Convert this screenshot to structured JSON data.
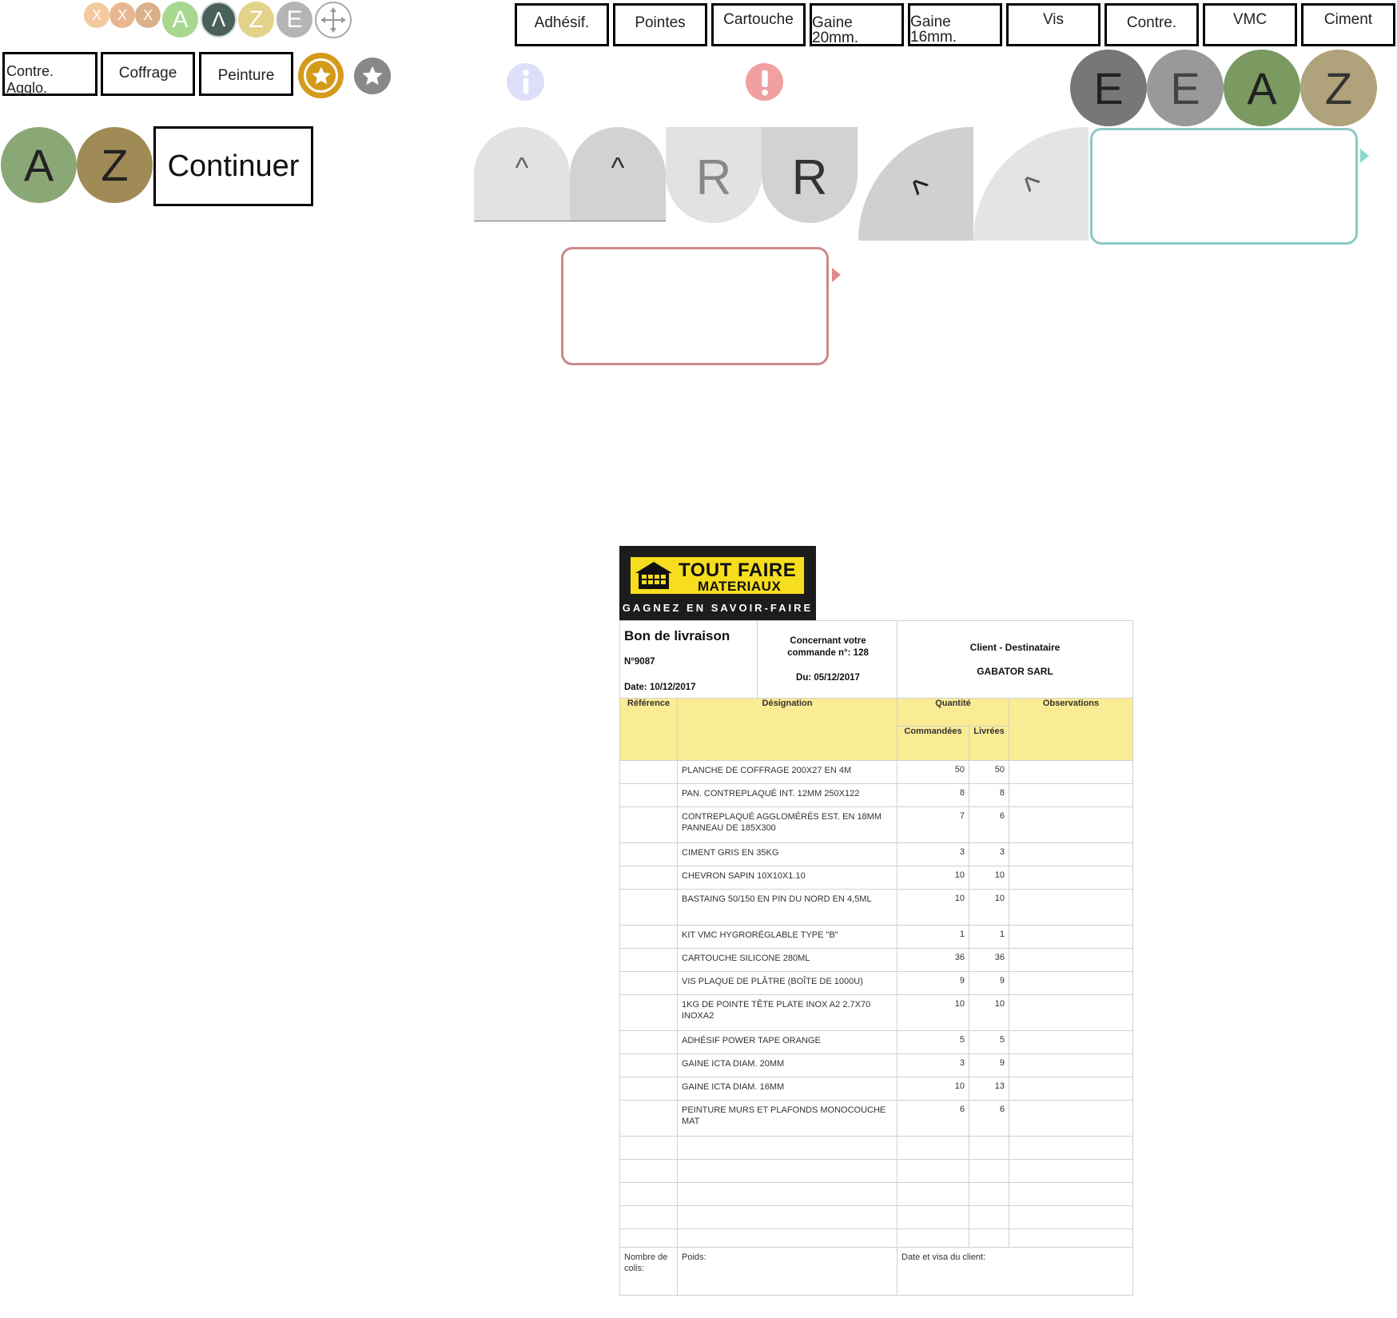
{
  "top_icons": {
    "x1": "X",
    "x2": "X",
    "x3": "X",
    "a": "A",
    "caret": "Λ",
    "z": "Z",
    "e": "E"
  },
  "top_buttons": [
    "Adhésif.",
    "Pointes",
    "Cartouche",
    "Gaine 20mm.",
    "Gaine 16mm.",
    "Vis",
    "Contre.",
    "VMC",
    "Ciment"
  ],
  "left_buttons": [
    "Contre. Agglo.",
    "Coffrage",
    "Peinture"
  ],
  "big_circles": {
    "a": "A",
    "z": "Z"
  },
  "continue_label": "Continuer",
  "right_circles": {
    "e1": "E",
    "e2": "E",
    "a": "A",
    "z": "Z"
  },
  "tabs": {
    "caret1": "^",
    "caret2": "^",
    "r1": "R",
    "r2": "R",
    "caret3": "^",
    "caret4": "^"
  },
  "colors": {
    "green": "#8aa876",
    "brown": "#a08a55",
    "gold": "#d49a1a",
    "teal": "#8cc8c4",
    "rose": "#c98a8a"
  },
  "icons": {
    "move": "move-arrows-icon",
    "star_gold": "star-icon",
    "star_gray": "star-icon",
    "info": "info-icon",
    "alert": "exclamation-icon"
  },
  "logo": {
    "line1": "TOUT FAIRE",
    "line2": "MATERIAUX",
    "tagline": "GAGNEZ EN SAVOIR-FAIRE"
  },
  "delivery_note": {
    "title": "Bon de livraison",
    "number": "N°9087",
    "date": "Date: 10/12/2017",
    "order_label": "Concernant votre commande n°: 128",
    "order_date": "Du: 05/12/2017",
    "client_label": "Client - Destinataire",
    "client_name": "GABATOR SARL",
    "headers": {
      "reference": "Référence",
      "designation": "Désignation",
      "quantity": "Quantité",
      "ordered": "Commandées",
      "delivered": "Livrées",
      "observations": "Observations"
    },
    "rows": [
      {
        "designation": "PLANCHE DE COFFRAGE 200X27 EN 4M",
        "ordered": "50",
        "delivered": "50"
      },
      {
        "designation": "PAN. CONTREPLAQUÉ INT. 12MM 250X122",
        "ordered": "8",
        "delivered": "8"
      },
      {
        "designation": "CONTREPLAQUÉ AGGLOMÉRÉS EST. EN 18MM PANNEAU DE 185X300",
        "ordered": "7",
        "delivered": "6"
      },
      {
        "designation": "CIMENT GRIS EN 35KG",
        "ordered": "3",
        "delivered": "3"
      },
      {
        "designation": "CHEVRON SAPIN 10X10X1.10",
        "ordered": "10",
        "delivered": "10"
      },
      {
        "designation": "BASTAING 50/150 EN PIN DU NORD EN 4,5ML",
        "ordered": "10",
        "delivered": "10"
      },
      {
        "designation": "KIT VMC HYGRORÉGLABLE TYPE \"B\"",
        "ordered": "1",
        "delivered": "1"
      },
      {
        "designation": "CARTOUCHE SILICONE 280ML",
        "ordered": "36",
        "delivered": "36"
      },
      {
        "designation": "VIS PLAQUE DE PLÂTRE (BOÎTE DE 1000U)",
        "ordered": "9",
        "delivered": "9"
      },
      {
        "designation": "1KG DE POINTE TÊTE PLATE INOX A2 2.7X70 INOXA2",
        "ordered": "10",
        "delivered": "10"
      },
      {
        "designation": "ADHÉSIF POWER TAPE ORANGE",
        "ordered": "5",
        "delivered": "5"
      },
      {
        "designation": "GAINE ICTA DIAM. 20MM",
        "ordered": "3",
        "delivered": "9"
      },
      {
        "designation": "GAINE ICTA DIAM. 16MM",
        "ordered": "10",
        "delivered": "13"
      },
      {
        "designation": "PEINTURE MURS ET PLAFONDS MONOCOUCHE MAT",
        "ordered": "6",
        "delivered": "6"
      }
    ],
    "footer": {
      "parcels": "Nombre de colis:",
      "weight": "Poids:",
      "signature": "Date et visa du client:"
    }
  }
}
